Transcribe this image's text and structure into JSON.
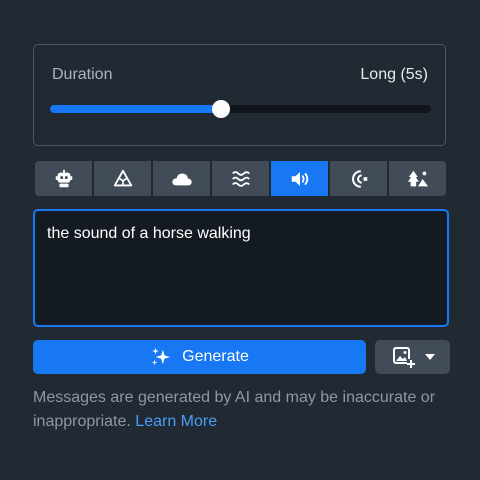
{
  "duration": {
    "label": "Duration",
    "value_label": "Long (5s)",
    "level": 0.45
  },
  "styles": [
    {
      "icon": "robot-icon",
      "active": false
    },
    {
      "icon": "geometry-icon",
      "active": false
    },
    {
      "icon": "cloud-icon",
      "active": false
    },
    {
      "icon": "waves-icon",
      "active": false
    },
    {
      "icon": "speaker-icon",
      "active": true
    },
    {
      "icon": "echo-icon",
      "active": false
    },
    {
      "icon": "nature-icon",
      "active": false
    }
  ],
  "prompt": {
    "text": "the sound of a horse walking"
  },
  "generate": {
    "label": "Generate",
    "icon": "sparkle-icon"
  },
  "image_button": {
    "icon": "add-image-icon",
    "dropdown_icon": "chevron-down-icon"
  },
  "disclaimer": {
    "text": "Messages are generated by AI and may be inaccurate or inappropriate.",
    "link": "Learn More"
  },
  "colors": {
    "accent": "#1877f2",
    "background": "#212a33",
    "link": "#4a9df8"
  }
}
